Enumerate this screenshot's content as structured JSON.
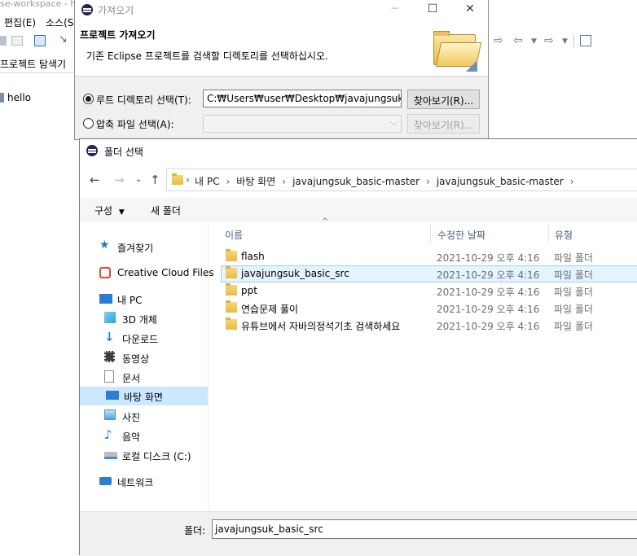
{
  "eclipse": {
    "window_title": "se-workspace - h",
    "menu": [
      "편집(E)",
      "소스(S"
    ],
    "explorer_tab": "프로젝트 탐색기",
    "tree_item": "hello"
  },
  "wizard": {
    "title": "가져오기",
    "heading": "프로젝트 가져오기",
    "description": "기존 Eclipse 프로젝트를 검색할 디렉토리를 선택하십시오.",
    "root_dir_label": "루트 디렉토리 선택(T):",
    "root_dir_value": "C:₩Users₩user₩Desktop₩javajungsuk_ba",
    "archive_label": "압축 파일 선택(A):",
    "archive_value": "",
    "browse_label": "찾아보기(R)...",
    "browse2_label": "찾아보기(R)..."
  },
  "dialog": {
    "title": "폴더 선택",
    "breadcrumbs": [
      "내 PC",
      "바탕 화면",
      "javajungsuk_basic-master",
      "javajungsuk_basic-master"
    ],
    "organize_label": "구성",
    "new_folder_label": "새 폴더",
    "columns": {
      "name": "이름",
      "date": "수정한 날짜",
      "type": "유형"
    },
    "nav": [
      {
        "label": "즐겨찾기",
        "icon": "star-icon"
      },
      {
        "label": "Creative Cloud Files",
        "icon": "creative-cloud-icon"
      },
      {
        "label": "내 PC",
        "icon": "pc-icon"
      },
      {
        "label": "3D 개체",
        "icon": "cube-icon"
      },
      {
        "label": "다운로드",
        "icon": "download-icon"
      },
      {
        "label": "동영상",
        "icon": "video-icon"
      },
      {
        "label": "문서",
        "icon": "document-icon"
      },
      {
        "label": "바탕 화면",
        "icon": "desktop-icon"
      },
      {
        "label": "사진",
        "icon": "picture-icon"
      },
      {
        "label": "음악",
        "icon": "music-icon"
      },
      {
        "label": "로컬 디스크 (C:)",
        "icon": "drive-icon"
      },
      {
        "label": "네트워크",
        "icon": "network-icon"
      }
    ],
    "selected_nav": "바탕 화면",
    "files": [
      {
        "name": "flash",
        "date": "2021-10-29 오후 4:16",
        "type": "파일 폴더"
      },
      {
        "name": "javajungsuk_basic_src",
        "date": "2021-10-29 오후 4:16",
        "type": "파일 폴더"
      },
      {
        "name": "ppt",
        "date": "2021-10-29 오후 4:16",
        "type": "파일 폴더"
      },
      {
        "name": "연습문제 풀이",
        "date": "2021-10-29 오후 4:16",
        "type": "파일 폴더"
      },
      {
        "name": "유튜브에서 자바의정석기초 검색하세요",
        "date": "2021-10-29 오후 4:16",
        "type": "파일 폴더"
      }
    ],
    "selected_file": "javajungsuk_basic_src",
    "folder_label": "폴더:",
    "folder_value": "javajungsuk_basic_src"
  },
  "colors": {
    "selection": "#cce8ff",
    "row_selection": "#e5f3ff",
    "folder": "#f8d775",
    "accent": "#0078d7"
  }
}
